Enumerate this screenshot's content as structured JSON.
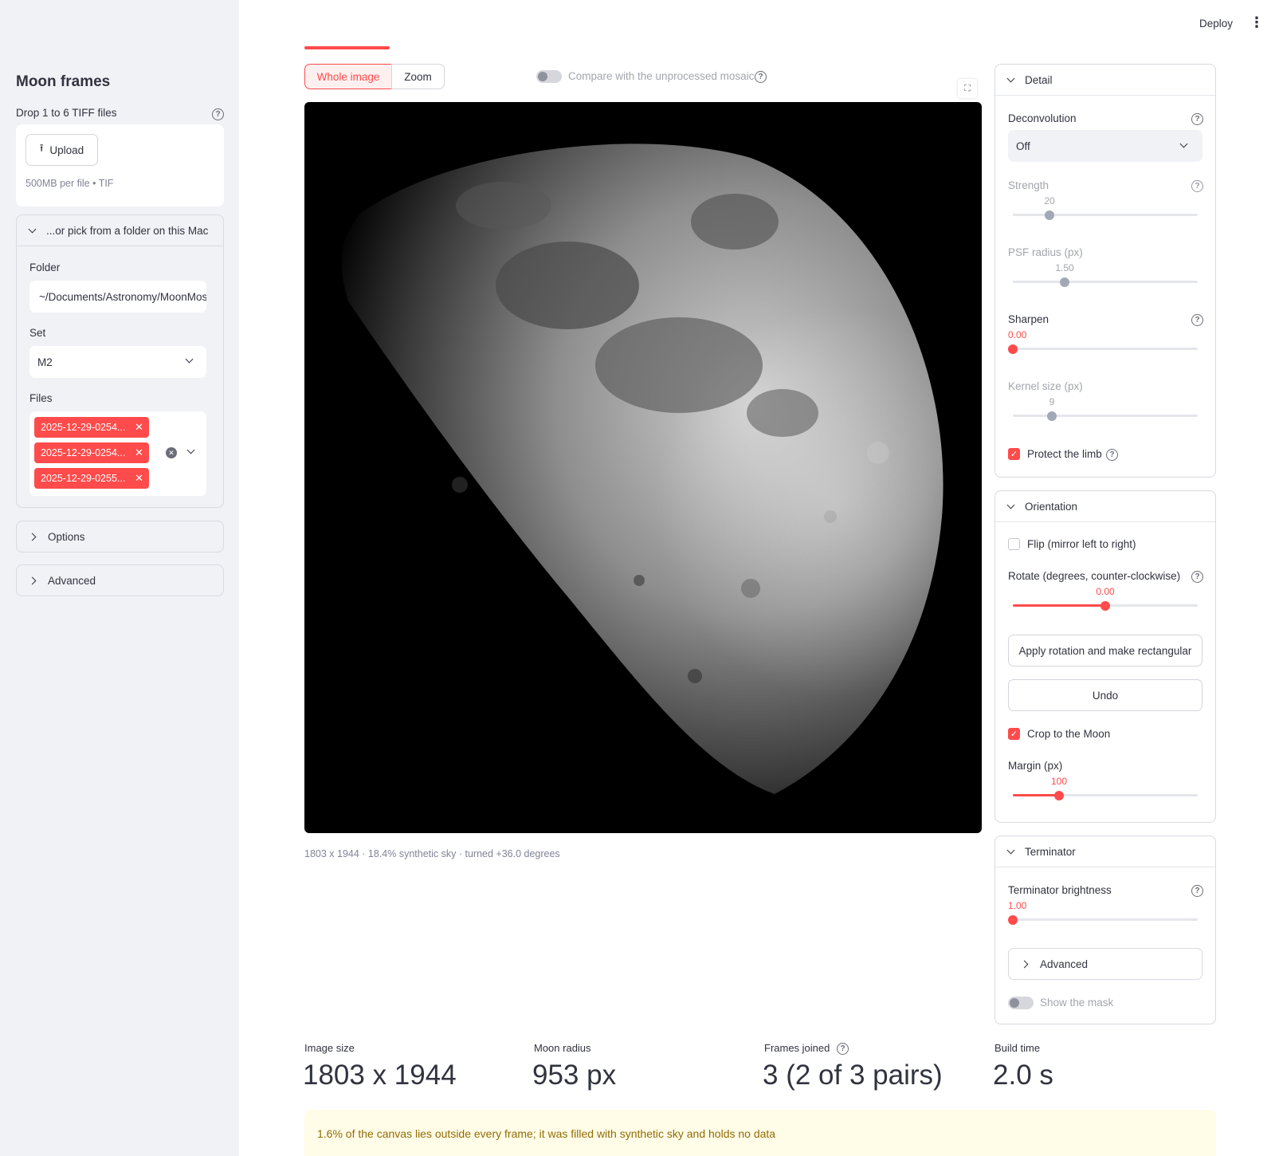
{
  "header": {
    "deploy_label": "Deploy",
    "menu_icon": "kebab-menu-icon"
  },
  "sidebar": {
    "title": "Moon frames",
    "uploader": {
      "label": "Drop 1 to 6 TIFF files",
      "button": "Upload",
      "hint": "500MB per file • TIF"
    },
    "folder_expander": {
      "label": "...or pick from a folder on this Mac",
      "folder_label": "Folder",
      "folder_value": "~/Documents/Astronomy/MoonMosaic",
      "set_label": "Set",
      "set_value": "M2",
      "files_label": "Files",
      "files": [
        "2025-12-29-0254...",
        "2025-12-29-0254...",
        "2025-12-29-0255..."
      ]
    },
    "options_label": "Options",
    "advanced_label": "Advanced"
  },
  "view": {
    "segments": [
      "Whole image",
      "Zoom"
    ],
    "selected": "Whole image",
    "compare_label": "Compare with the unprocessed mosaic",
    "caption": "1803 x 1944 · 18.4% synthetic sky · turned +36.0 degrees"
  },
  "detail": {
    "title": "Detail",
    "deconvolution_label": "Deconvolution",
    "deconvolution_value": "Off",
    "strength_label": "Strength",
    "strength_value": "20",
    "psf_label": "PSF radius (px)",
    "psf_value": "1.50",
    "sharpen_label": "Sharpen",
    "sharpen_value": "0.00",
    "kernel_label": "Kernel size (px)",
    "kernel_value": "9",
    "protect_label": "Protect the limb"
  },
  "orientation": {
    "title": "Orientation",
    "flip_label": "Flip (mirror left to right)",
    "rotate_label": "Rotate (degrees, counter-clockwise)",
    "rotate_value": "0.00",
    "apply_button": "Apply rotation and make rectangular",
    "undo_button": "Undo",
    "crop_label": "Crop to the Moon",
    "margin_label": "Margin (px)",
    "margin_value": "100"
  },
  "terminator": {
    "title": "Terminator",
    "brightness_label": "Terminator brightness",
    "brightness_value": "1.00",
    "advanced_label": "Advanced",
    "mask_label": "Show the mask"
  },
  "metrics": [
    {
      "label": "Image size",
      "value": "1803 x 1944"
    },
    {
      "label": "Moon radius",
      "value": "953 px"
    },
    {
      "label": "Frames joined",
      "value": "3 (2 of 3 pairs)"
    },
    {
      "label": "Build time",
      "value": "2.0 s"
    }
  ],
  "warning": "1.6% of the canvas lies outside every frame; it was filled with synthetic sky and holds no data",
  "slider_levels": {
    "strength": 0.2,
    "psf": 0.3,
    "sharpen": 0.0,
    "kernel": 0.2,
    "rotate": 0.5,
    "margin": 0.25,
    "terminator": 0.0
  },
  "colors": {
    "accent": "#ff4b4b",
    "sidebar_bg": "#f0f2f6",
    "warning_bg": "#fffce7",
    "warning_text": "#926c05"
  }
}
